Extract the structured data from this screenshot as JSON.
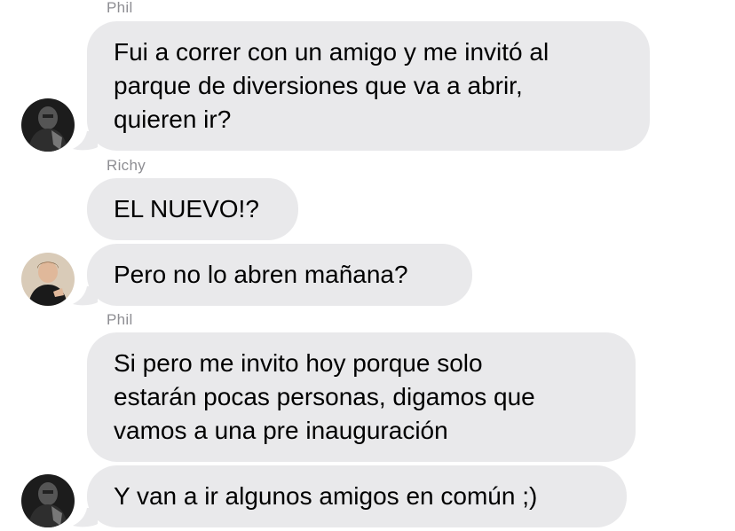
{
  "messages": [
    {
      "sender": "Phil",
      "text": "Fui a correr con un amigo y me invitó al\nparque de diversiones que va a abrir,\nquieren ir?"
    },
    {
      "sender": "Richy",
      "text": "EL NUEVO!?"
    },
    {
      "text": "Pero no lo abren mañana?"
    },
    {
      "sender": "Phil",
      "text": "Si pero me invito hoy porque solo\nestarán pocas personas, digamos que\nvamos a una pre inauguración"
    },
    {
      "text": "Y van a ir algunos amigos en común ;)"
    }
  ],
  "colors": {
    "bubble": "#e9e9eb",
    "sender_name": "#8e8e93",
    "background": "#ffffff"
  },
  "icons": {
    "avatar_phil": "person-photo-dark",
    "avatar_richy": "person-photo-light"
  }
}
